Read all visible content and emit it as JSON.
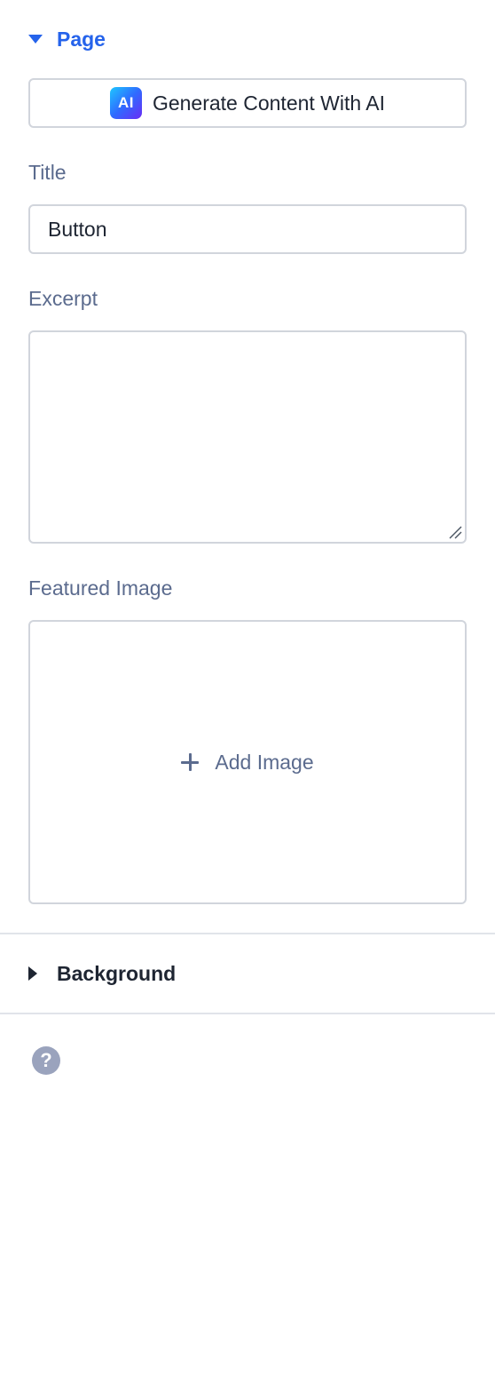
{
  "page_section": {
    "title": "Page",
    "expanded": true,
    "accent_color": "#2563eb"
  },
  "ai_button": {
    "badge": "AI",
    "label": "Generate Content With AI"
  },
  "fields": {
    "title_label": "Title",
    "title_value": "Button",
    "excerpt_label": "Excerpt",
    "excerpt_value": "",
    "featured_image_label": "Featured Image",
    "add_image_label": "Add Image"
  },
  "background_section": {
    "title": "Background",
    "expanded": false
  },
  "help": {
    "icon": "question-circle-icon",
    "glyph": "?"
  },
  "colors": {
    "accent": "#2563eb",
    "label": "#5b6b8e",
    "border": "#d1d5dc",
    "help_icon": "#9aa3bd"
  }
}
